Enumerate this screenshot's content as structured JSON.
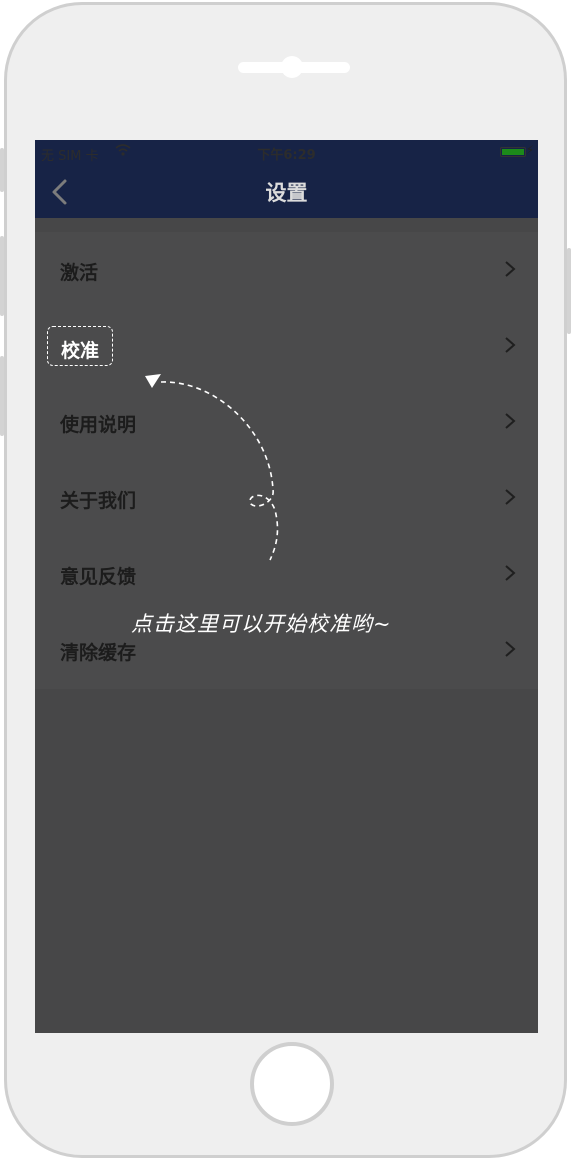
{
  "status_bar": {
    "carrier": "无 SIM 卡",
    "time": "下午6:29"
  },
  "nav": {
    "title": "设置"
  },
  "menu": {
    "items": [
      {
        "label": "激活"
      },
      {
        "label": "校准"
      },
      {
        "label": "使用说明"
      },
      {
        "label": "关于我们"
      },
      {
        "label": "意见反馈"
      },
      {
        "label": "清除缓存"
      }
    ]
  },
  "tutorial": {
    "highlighted_item": "校准",
    "hint": "点击这里可以开始校准哟~"
  },
  "colors": {
    "navbar": "#172346",
    "overlay": "#474748",
    "frame": "#efefef"
  }
}
